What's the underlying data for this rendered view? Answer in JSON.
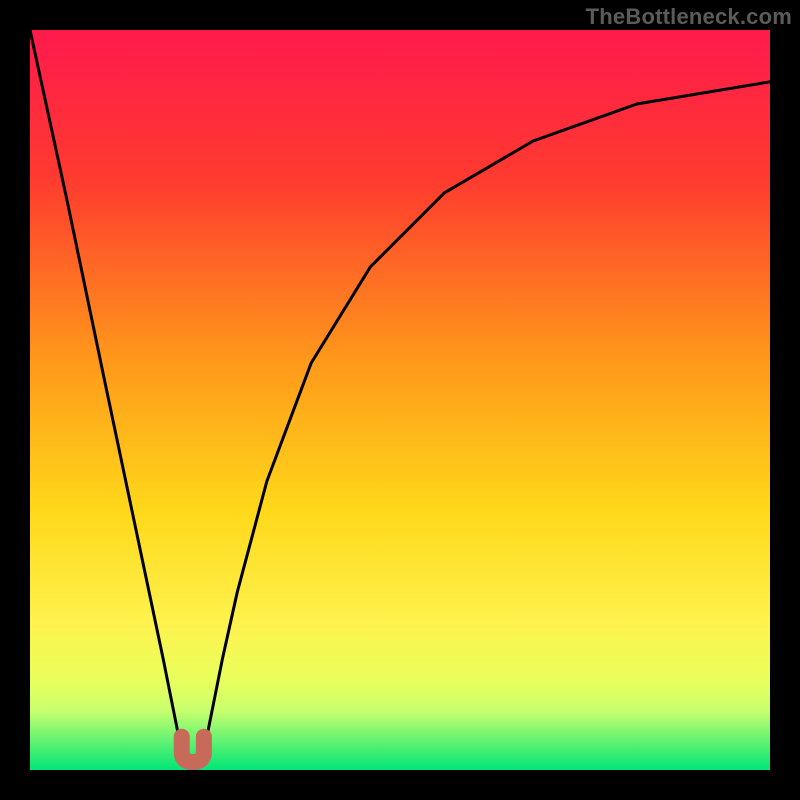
{
  "watermark": "TheBottleneck.com",
  "colors": {
    "frame": "#000000",
    "gradient_stops": [
      {
        "offset": 0,
        "color": "#ff1a4d"
      },
      {
        "offset": 20,
        "color": "#ff3a2f"
      },
      {
        "offset": 45,
        "color": "#ff9a1a"
      },
      {
        "offset": 65,
        "color": "#ffd81a"
      },
      {
        "offset": 80,
        "color": "#fff24d"
      },
      {
        "offset": 88,
        "color": "#e8ff5c"
      },
      {
        "offset": 92,
        "color": "#c8ff6e"
      },
      {
        "offset": 100,
        "color": "#00e676"
      }
    ],
    "curve": "#000000",
    "marker_fill": "#c86a5a",
    "marker_stroke": "#c86a5a"
  },
  "chart_data": {
    "type": "line",
    "title": "",
    "xlabel": "",
    "ylabel": "",
    "xlim": [
      0,
      100
    ],
    "ylim": [
      0,
      100
    ],
    "x": [
      0,
      5,
      10,
      14,
      18,
      19,
      20,
      20.8,
      21.6,
      22,
      22.4,
      23.2,
      24,
      25,
      26,
      28,
      32,
      38,
      46,
      56,
      68,
      82,
      100
    ],
    "values": [
      100,
      77,
      53,
      34,
      15,
      10,
      5,
      1.2,
      0.4,
      0.3,
      0.4,
      1.2,
      5,
      10,
      15,
      24,
      39,
      55,
      68,
      78,
      85,
      90,
      93
    ],
    "minimum": {
      "x": 22,
      "y": 0.3
    },
    "marker": {
      "x_start": 20.5,
      "x_end": 23.5,
      "y_top": 4.5,
      "y_bottom": 0
    }
  }
}
